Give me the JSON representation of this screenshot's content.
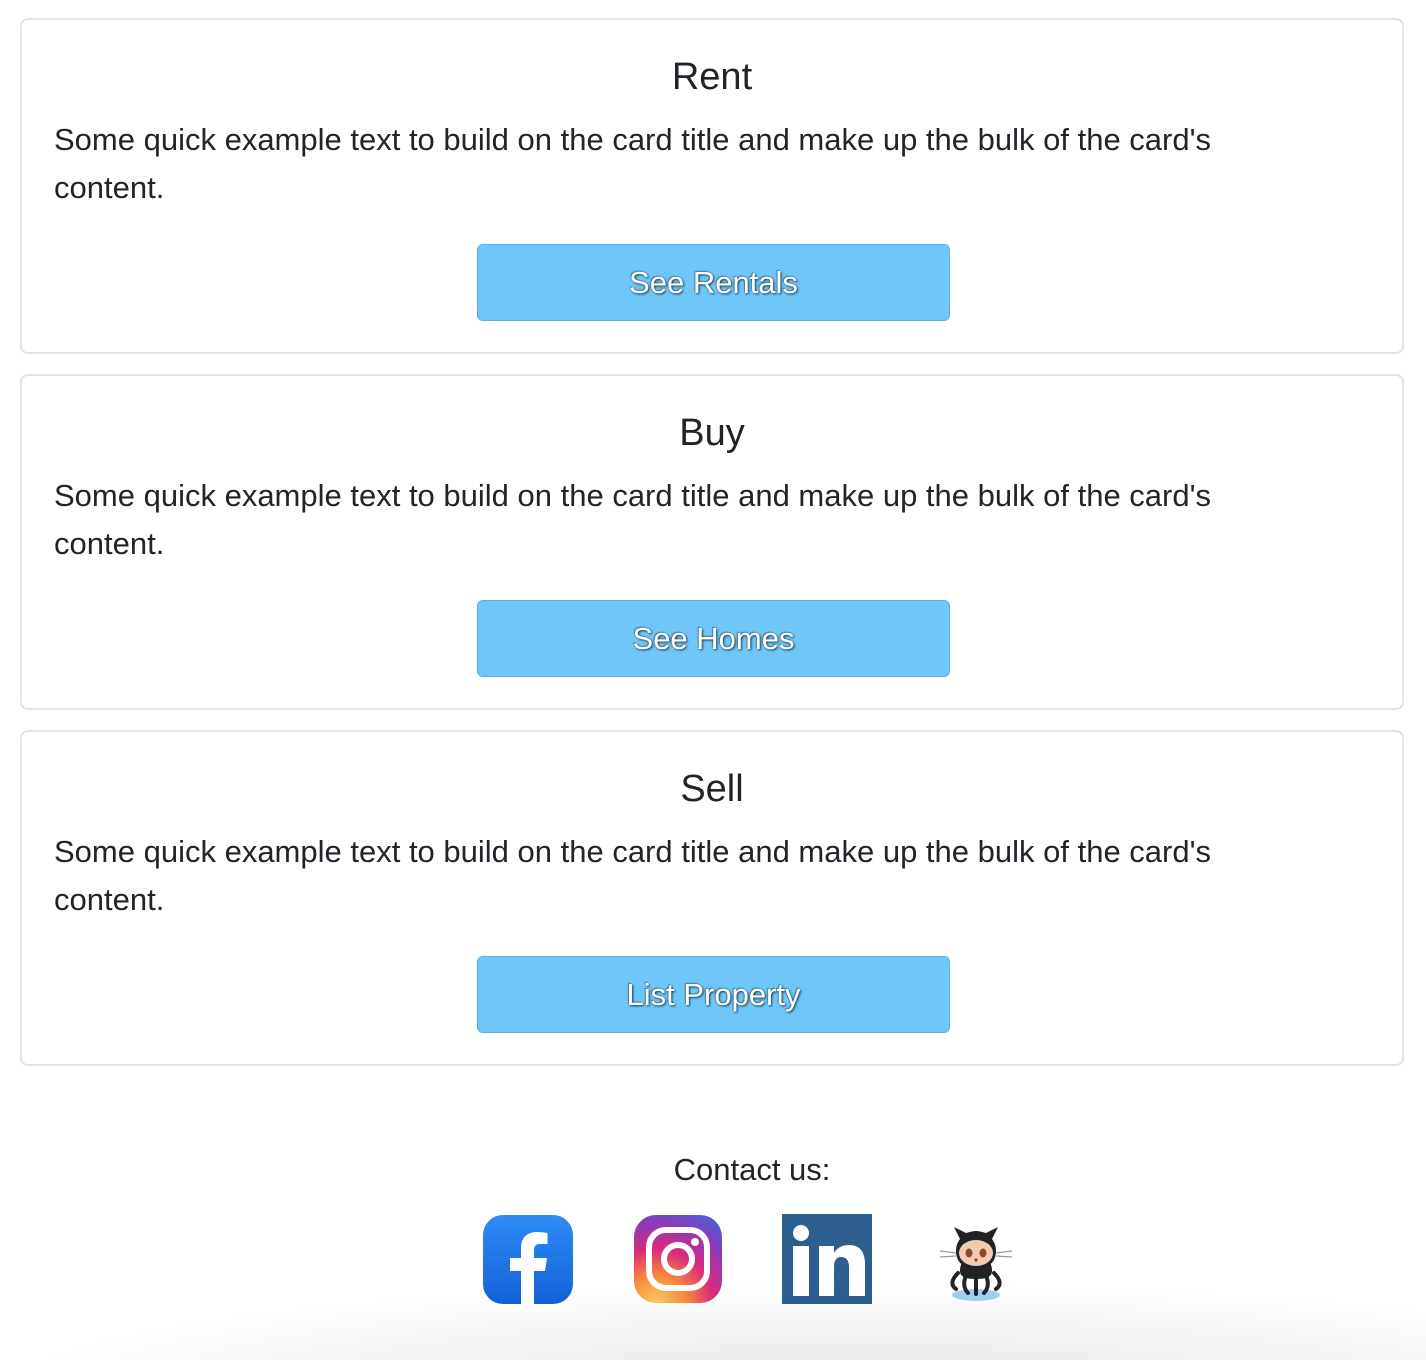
{
  "cards": [
    {
      "title": "Rent",
      "text": "Some quick example text to build on the card title and make up the bulk of the card's content.",
      "button_label": "See Rentals"
    },
    {
      "title": "Buy",
      "text": "Some quick example text to build on the card title and make up the bulk of the card's content.",
      "button_label": "See Homes"
    },
    {
      "title": "Sell",
      "text": "Some quick example text to build on the card title and make up the bulk of the card's content.",
      "button_label": "List Property"
    }
  ],
  "footer": {
    "contact_label": "Contact us:",
    "social_icons": [
      "facebook-icon",
      "instagram-icon",
      "linkedin-icon",
      "github-octocat-icon"
    ]
  },
  "colors": {
    "button_bg": "#6ec6f9",
    "facebook": "#1877f2",
    "linkedin": "#2d5f8e"
  }
}
